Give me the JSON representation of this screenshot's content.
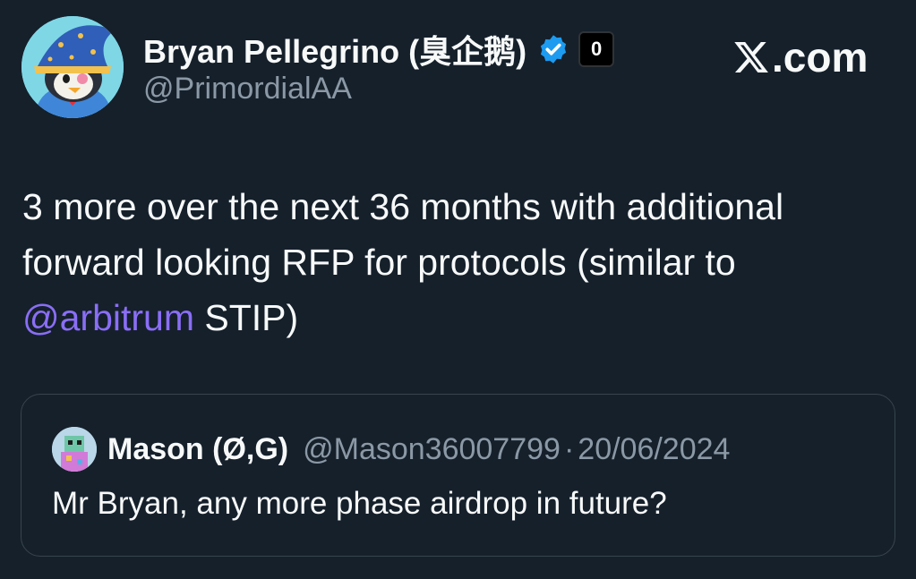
{
  "tweet": {
    "author": {
      "name": "Bryan Pellegrino (臭企鹅)",
      "handle": "@PrimordialAA",
      "badge_label": "0",
      "avatar_icon": "penguin-wizard-avatar",
      "verified_icon": "verified-badge-icon"
    },
    "source": {
      "label": ".com",
      "icon": "x-logo-icon"
    },
    "body": {
      "line1": "3 more over the next 36 months with additional",
      "line2": "forward looking RFP for protocols (similar to",
      "mention": "@arbitrum",
      "after_mention": " STIP)"
    },
    "quote": {
      "name": "Mason (Ø,G)",
      "handle": "@Mason36007799",
      "separator": "·",
      "date": "20/06/2024",
      "text": "Mr Bryan, any more phase airdrop in future?",
      "avatar_icon": "pixel-avatar"
    }
  },
  "colors": {
    "background": "#15202b",
    "text_primary": "#f7f9f9",
    "text_secondary": "#8b98a5",
    "mention": "#8a6ef5",
    "verified": "#1d9bf0",
    "border": "#38444d"
  }
}
